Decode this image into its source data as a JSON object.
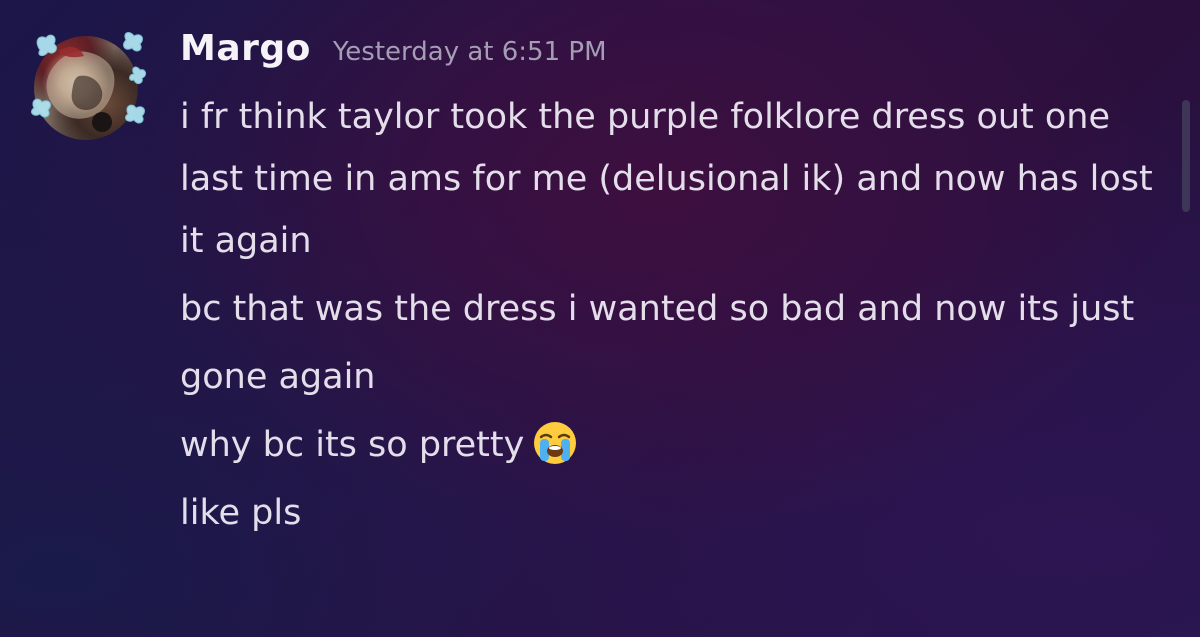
{
  "message": {
    "author": "Margo",
    "timestamp": "Yesterday at 6:51 PM",
    "avatar_icon": "user-avatar",
    "lines": [
      "i fr think taylor took the purple folklore dress out one last time in ams for me (delusional ik) and now has lost it again",
      "bc that was the dress i wanted so bad and now its just",
      "gone again",
      "why bc its so pretty",
      "like pls"
    ],
    "emoji": "loudly-crying-face-icon"
  },
  "colors": {
    "author": "#f5f2f8",
    "timestamp": "#a59db4",
    "text": "#e3deea"
  }
}
